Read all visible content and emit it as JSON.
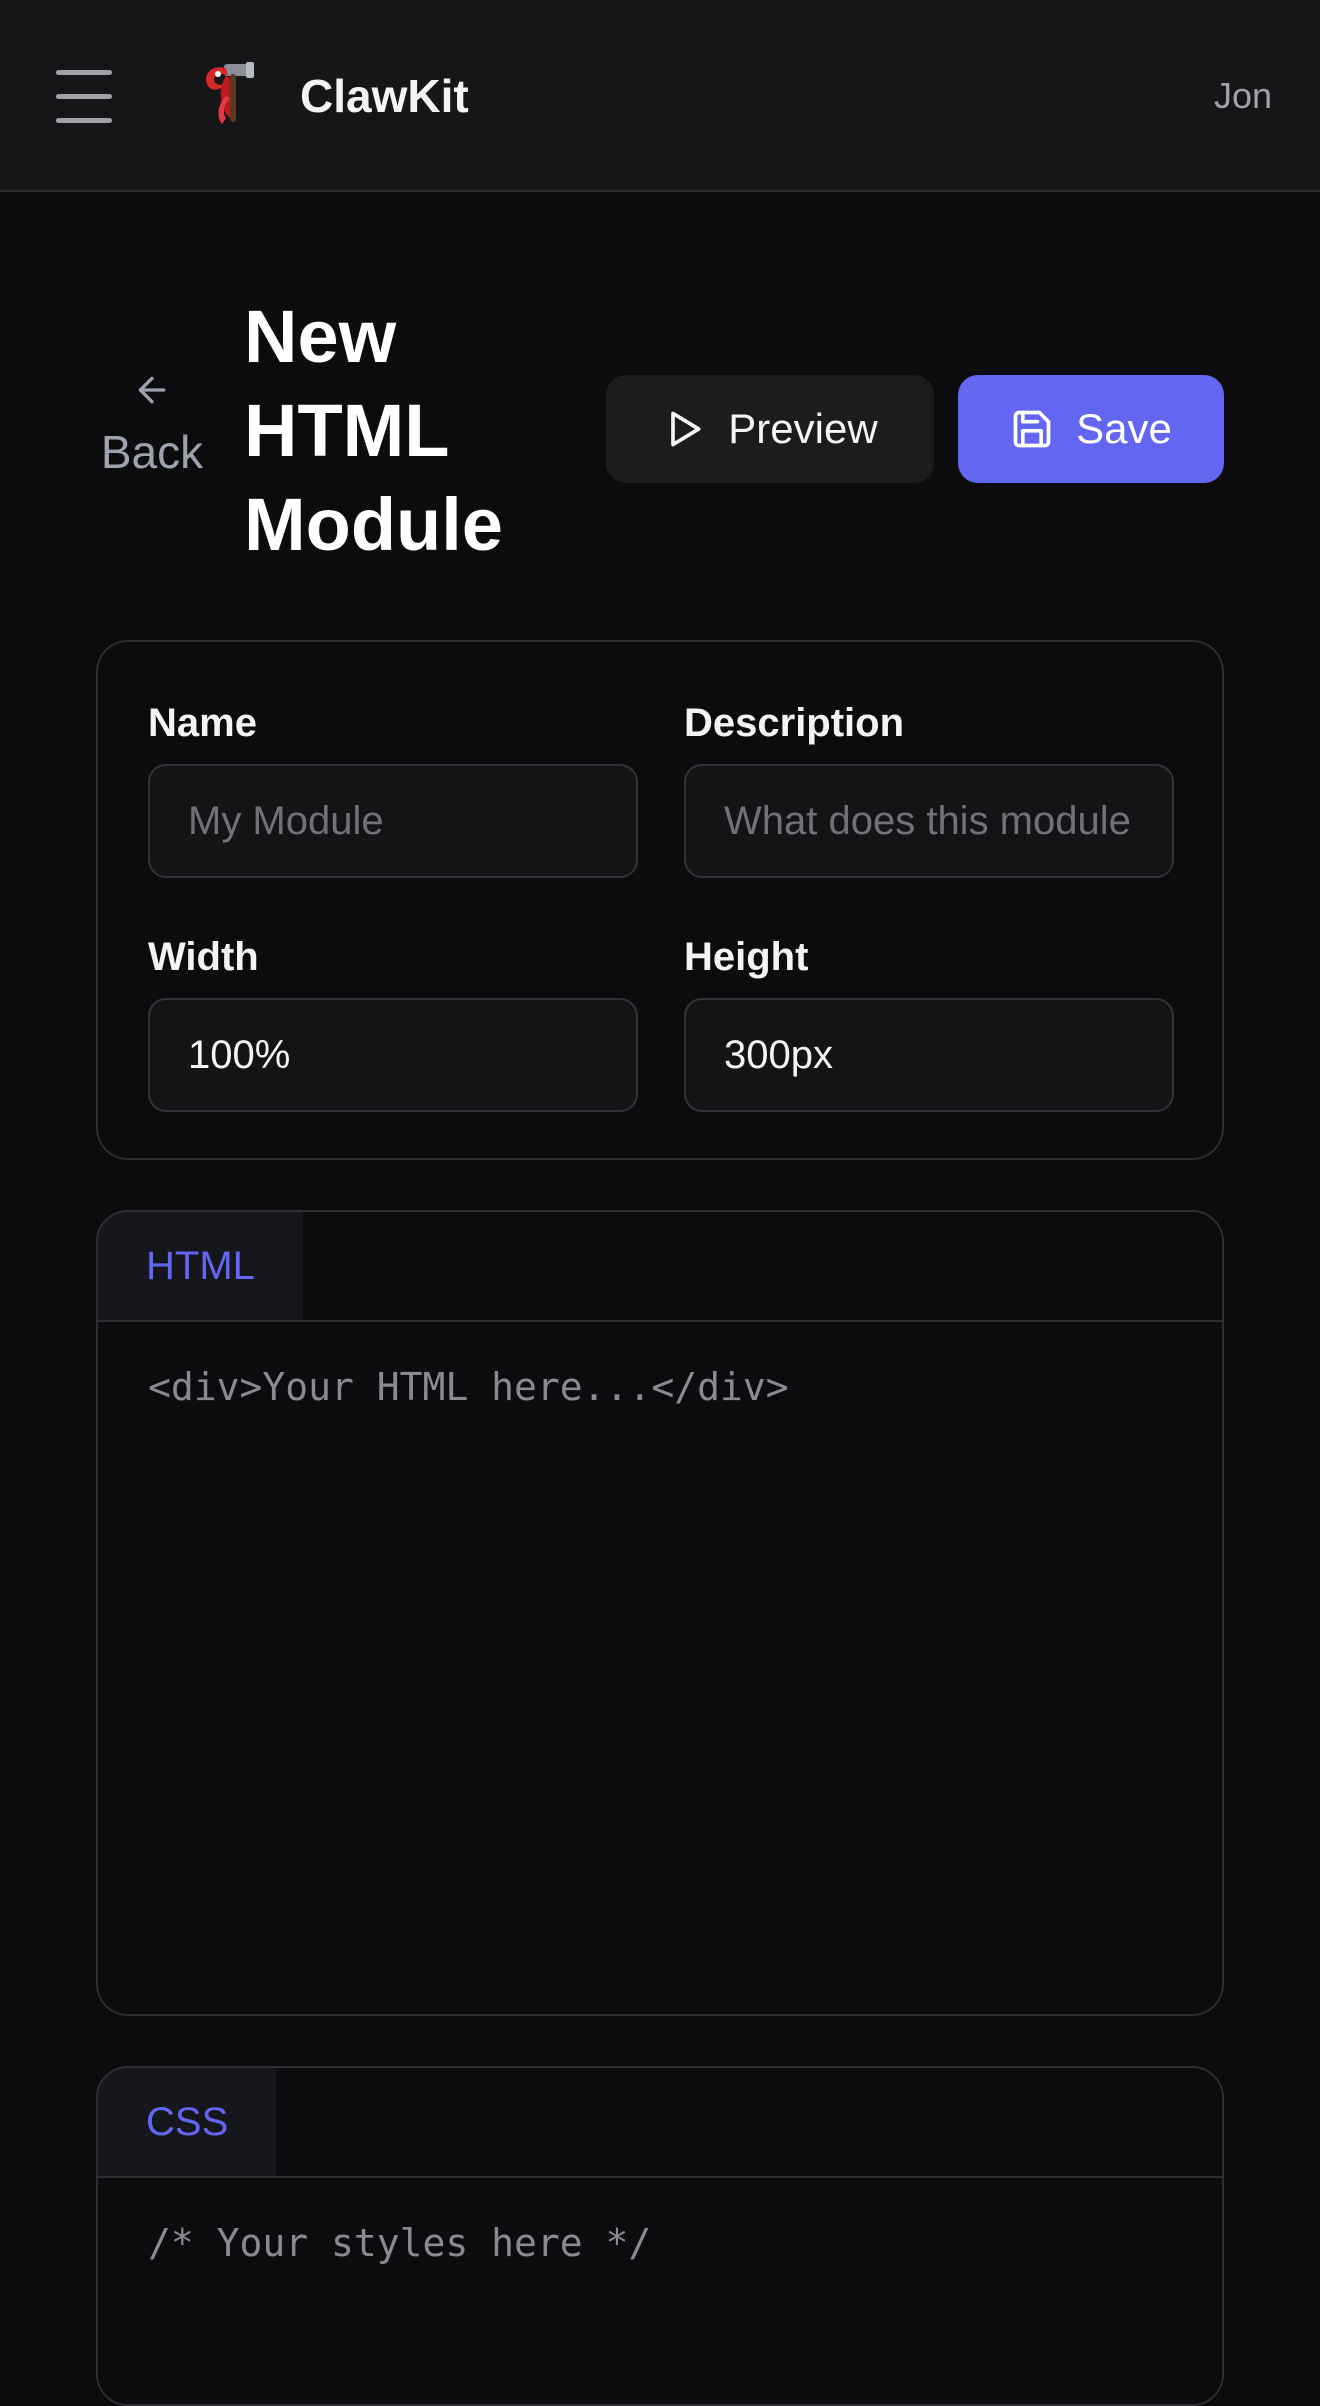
{
  "header": {
    "brand": "ClawKit",
    "user": "Jon"
  },
  "icons": {
    "menu": "menu-icon",
    "logo": "claw-hammer-logo-icon",
    "back": "arrow-left-icon",
    "preview": "play-icon",
    "save": "save-icon"
  },
  "page": {
    "back_label": "Back",
    "title": "New HTML Module",
    "preview_label": "Preview",
    "save_label": "Save"
  },
  "form": {
    "name_label": "Name",
    "name_placeholder": "My Module",
    "description_label": "Description",
    "description_placeholder": "What does this module do?",
    "width_label": "Width",
    "width_value": "100%",
    "height_label": "Height",
    "height_value": "300px"
  },
  "editors": {
    "html_tab": "HTML",
    "html_placeholder": "<div>Your HTML here...</div>",
    "css_tab": "CSS",
    "css_placeholder": "/* Your styles here */"
  },
  "colors": {
    "accent": "#6366f1",
    "background": "#0c0c0e",
    "header_bg": "#161618",
    "border": "#2e2e33",
    "muted_text": "#a1a1aa"
  }
}
